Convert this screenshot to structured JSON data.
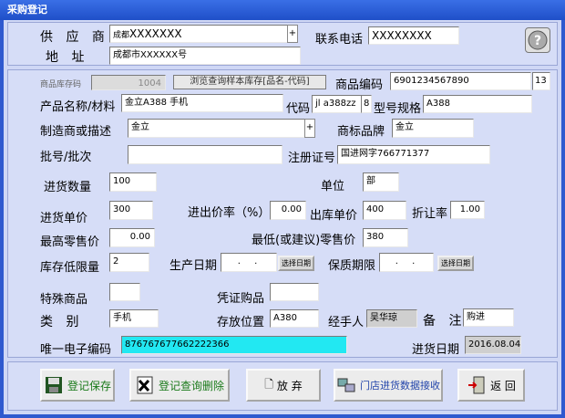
{
  "title": "采购登记",
  "supplier": {
    "label": "供 应 商",
    "value_prefix": "成都",
    "value": "XXXXXXX",
    "spin": "+"
  },
  "phone": {
    "label": "联系电话",
    "value": "XXXXXXXX"
  },
  "address": {
    "label": "地  址",
    "value": "成都市XXXXXX号"
  },
  "lib_code": {
    "label": "商品库存码",
    "value": "1004"
  },
  "browse_btn": "浏览查询样本库存[品名-代码]",
  "goods_code": {
    "label": "商品编码",
    "value": "6901234567890",
    "extra": "13"
  },
  "product_name": {
    "label": "产品名称/材料",
    "value": "金立A388 手机"
  },
  "code": {
    "label": "代码",
    "value": "jl a388zz",
    "extra": "8"
  },
  "model": {
    "label": "型号规格",
    "value": "A388"
  },
  "maker": {
    "label": "制造商或描述",
    "value": "金立",
    "spin": "+"
  },
  "brand": {
    "label": "商标品牌",
    "value": "金立"
  },
  "batch": {
    "label": "批号/批次",
    "value": ""
  },
  "reg": {
    "label": "注册证号",
    "value": "国进网字766771377"
  },
  "qty": {
    "label": "进货数量",
    "value": "100"
  },
  "unit": {
    "label": "单位",
    "value": "部"
  },
  "price": {
    "label": "进货单价",
    "value": "300"
  },
  "rate": {
    "label": "进出价率（%）",
    "value": "0.00"
  },
  "out_price": {
    "label": "出库单价",
    "value": "400"
  },
  "discount": {
    "label": "折让率",
    "value": "1.00"
  },
  "max_retail": {
    "label": "最高零售价",
    "value": "0.00"
  },
  "min_retail": {
    "label": "最低(或建议)零售价",
    "value": "380"
  },
  "min_stock": {
    "label": "库存低限量",
    "value": "2"
  },
  "prod_date": {
    "label": "生产日期",
    "value": ". .",
    "btn": "选择日期"
  },
  "shelf": {
    "label": "保质期限",
    "value": ". .",
    "btn": "选择日期"
  },
  "special": {
    "label": "特殊商品",
    "value": ""
  },
  "voucher": {
    "label": "凭证购品",
    "value": ""
  },
  "category": {
    "label": "类  别",
    "value": "手机"
  },
  "location": {
    "label": "存放位置",
    "value": "A380"
  },
  "handler": {
    "label": "经手人",
    "value": "吴华琼"
  },
  "remark": {
    "label": "备  注",
    "value": "购进"
  },
  "ecode": {
    "label": "唯一电子编码",
    "value": "876767677662222366"
  },
  "in_date": {
    "label": "进货日期",
    "value": "2016.08.04"
  },
  "buttons": {
    "save": "登记保存",
    "del": "登记查询删除",
    "abandon": "放 弃",
    "store": "门店进货数据接收",
    "back": "返 回"
  },
  "colors": {
    "title": "#2f59cf",
    "panel": "#cfd7f5",
    "cyan": "#22e8f2"
  }
}
